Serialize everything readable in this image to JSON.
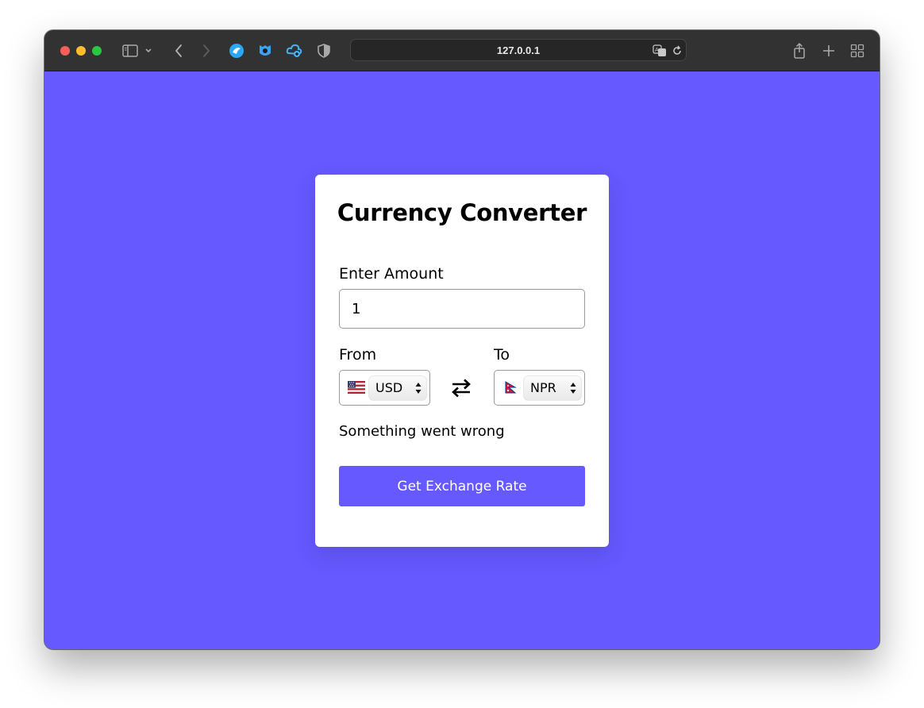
{
  "browser": {
    "url": "127.0.0.1",
    "icons": [
      "sidebar-toggle-icon",
      "chevron-down-icon",
      "back-icon",
      "forward-icon",
      "extension-icon",
      "shield-extension-icon",
      "extension-cloud-icon",
      "privacy-shield-icon",
      "translate-icon",
      "reload-icon",
      "share-icon",
      "new-tab-icon",
      "tab-overview-icon"
    ]
  },
  "converter": {
    "title": "Currency Converter",
    "amount_label": "Enter Amount",
    "amount_value": "1",
    "from_label": "From",
    "to_label": "To",
    "from_currency": "USD",
    "to_currency": "NPR",
    "status_message": "Something went wrong",
    "button_label": "Get Exchange Rate"
  },
  "colors": {
    "background": "#6559ff",
    "button": "#6559ff",
    "card": "#ffffff"
  }
}
